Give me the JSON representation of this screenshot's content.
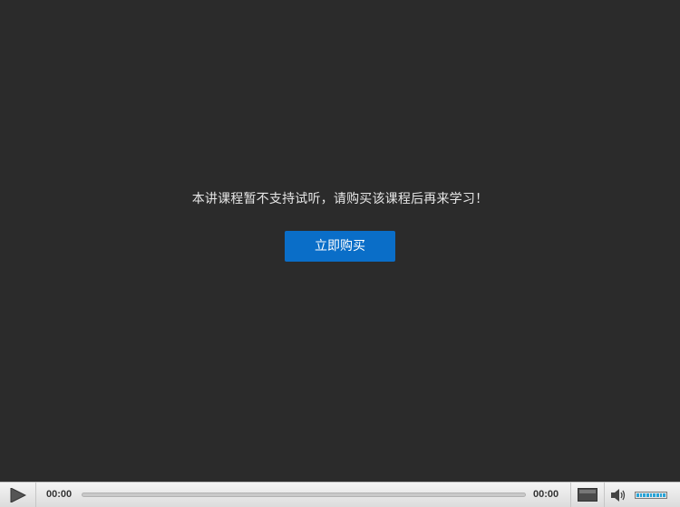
{
  "player": {
    "notice_text": "本讲课程暂不支持试听，请购买该课程后再来学习！",
    "buy_button_label": "立即购买",
    "colors": {
      "background": "#2b2b2b",
      "buy_button": "#0a6ec8",
      "volume_fill": "#27a4d8"
    }
  },
  "controls": {
    "play_icon": "play-icon",
    "current_time": "00:00",
    "total_time": "00:00",
    "progress": 0,
    "fullscreen_icon": "fullscreen-icon",
    "volume_icon": "volume-icon",
    "volume_level": 1.0
  }
}
